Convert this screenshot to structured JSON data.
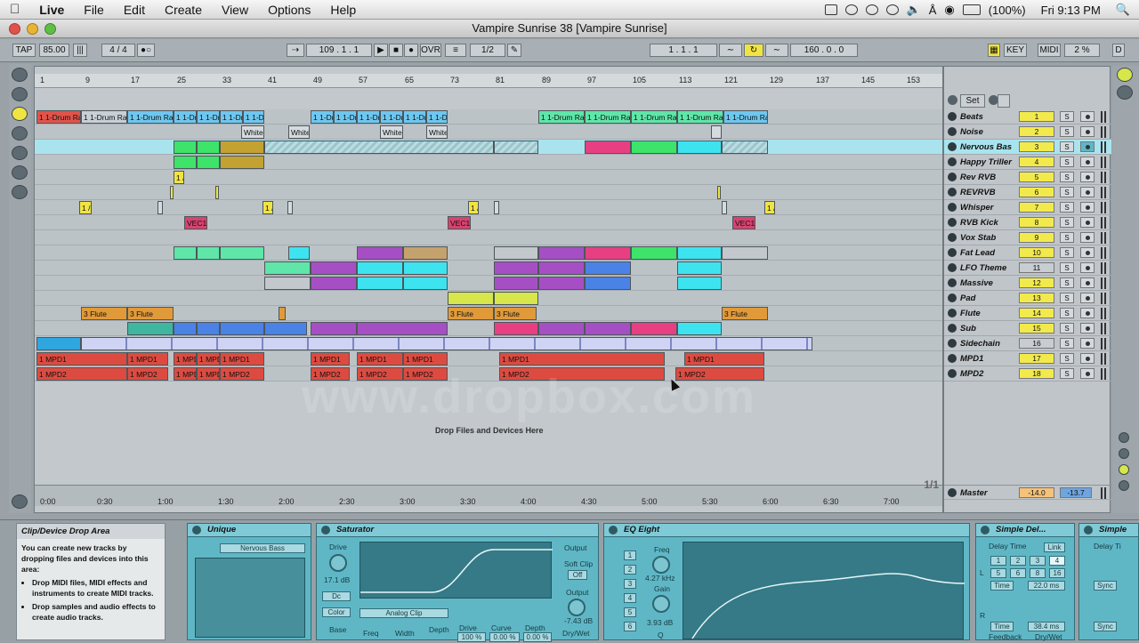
{
  "menubar": {
    "apple": "",
    "items": [
      "Live",
      "File",
      "Edit",
      "Create",
      "View",
      "Options",
      "Help"
    ],
    "battery": "(100%)",
    "clock": "Fri 9:13 PM"
  },
  "window": {
    "title": "Vampire Sunrise 38  [Vampire Sunrise]"
  },
  "transport": {
    "tap": "TAP",
    "tempo": "85.00",
    "sig": "4 / 4",
    "position": "109 . 1 . 1",
    "ovr": "OVR",
    "quant": "1/2",
    "loop_start": "1 . 1 . 1",
    "loop_len": "160 . 0 . 0",
    "key": "KEY",
    "midi": "MIDI",
    "cpu": "2 %",
    "d": "D"
  },
  "ruler": [
    "1",
    "9",
    "17",
    "25",
    "33",
    "41",
    "49",
    "57",
    "65",
    "73",
    "81",
    "89",
    "97",
    "105",
    "113",
    "121",
    "129",
    "137",
    "145",
    "153"
  ],
  "timeline": [
    "0:00",
    "0:30",
    "1:00",
    "1:30",
    "2:00",
    "2:30",
    "3:00",
    "3:30",
    "4:00",
    "4:30",
    "5:00",
    "5:30",
    "6:00",
    "6:30",
    "7:00"
  ],
  "set_label": "Set",
  "drop_label": "Drop Files and Devices Here",
  "tracks": [
    {
      "name": "Beats",
      "num": "1"
    },
    {
      "name": "Noise",
      "num": "2"
    },
    {
      "name": "Nervous Bas",
      "num": "3"
    },
    {
      "name": "Happy Triller",
      "num": "4"
    },
    {
      "name": "Rev RVB",
      "num": "5"
    },
    {
      "name": "REVRVB",
      "num": "6"
    },
    {
      "name": "Whisper",
      "num": "7"
    },
    {
      "name": "RVB Kick",
      "num": "8"
    },
    {
      "name": "Vox Stab",
      "num": "9"
    },
    {
      "name": "Fat Lead",
      "num": "10"
    },
    {
      "name": "LFO Theme",
      "num": "11"
    },
    {
      "name": "Massive",
      "num": "12"
    },
    {
      "name": "Pad",
      "num": "13"
    },
    {
      "name": "Flute",
      "num": "14"
    },
    {
      "name": "Sub",
      "num": "15"
    },
    {
      "name": "Sidechain",
      "num": "16"
    },
    {
      "name": "MPD1",
      "num": "17"
    },
    {
      "name": "MPD2",
      "num": "18"
    }
  ],
  "solo_label": "S",
  "master": {
    "name": "Master",
    "vol": "-14.0",
    "pan": "-13.7",
    "page": "1/1"
  },
  "clip_labels": {
    "drum": "1 1-Drum Ra",
    "drum2": "1 1-Dr",
    "white": "White",
    "vec": "VEC1",
    "flute": "3 Flute",
    "mpd1": "1 MPD1",
    "mpd2": "1 MPD2",
    "short": "1 /"
  },
  "info": {
    "title": "Clip/Device Drop Area",
    "body": "You can create new tracks by dropping files and devices into this area:",
    "bullets": [
      "Drop MIDI files, MIDI effects and instruments to create MIDI tracks.",
      "Drop samples and audio effects to create audio tracks."
    ]
  },
  "devices": {
    "unique": {
      "title": "Unique",
      "preset": "Nervous Bass"
    },
    "saturator": {
      "title": "Saturator",
      "drive": "Drive",
      "drive_val": "17.1 dB",
      "dc": "Dc",
      "color": "Color",
      "mode": "Analog Clip",
      "base": "Base",
      "freq": "Freq",
      "width": "Width",
      "depth": "Depth",
      "drive2": "Drive",
      "drive2_val": "100 %",
      "curve": "Curve",
      "curve_val": "0.00 %",
      "depth2": "Depth",
      "depth2_val": "0.00 %",
      "output_label": "Output",
      "softclip": "Soft Clip",
      "off": "Off",
      "output": "Output",
      "output_val": "-7.43 dB",
      "drywet": "Dry/Wet"
    },
    "eq": {
      "title": "EQ Eight",
      "freq": "Freq",
      "freq_val": "4.27 kHz",
      "gain": "Gain",
      "gain_val": "3.93 dB",
      "q": "Q",
      "bands": [
        "1",
        "2",
        "3",
        "4",
        "5",
        "6"
      ]
    },
    "delay": {
      "title": "Simple Del...",
      "delay_time": "Delay Time",
      "link": "Link",
      "l": "L",
      "r": "R",
      "time": "Time",
      "left_val": "22.0 ms",
      "right_val": "38.4 ms",
      "feedback": "Feedback",
      "drywet": "Dry/Wet",
      "grid": [
        "1",
        "2",
        "3",
        "4",
        "5",
        "6",
        "8",
        "16"
      ]
    },
    "simple2": {
      "title": "Simple",
      "delay": "Delay Ti",
      "sync": "Sync"
    }
  },
  "watermark": "www.dropbox.com"
}
